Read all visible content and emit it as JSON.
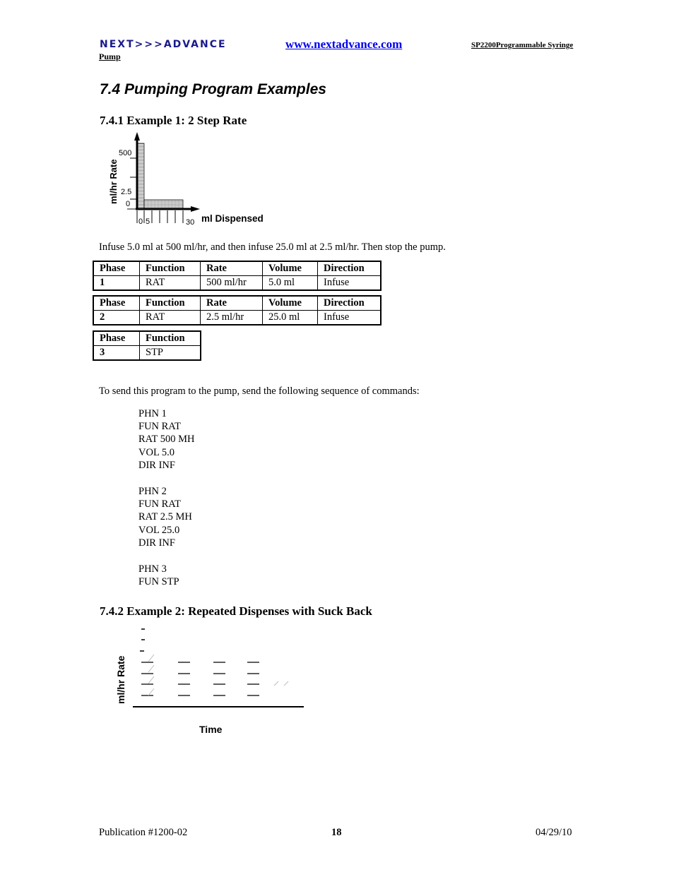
{
  "header": {
    "logo": "NEXT>>>ADVANCE",
    "pump": "Pump",
    "url": "www.nextadvance.com",
    "product": "SP2200Programmable Syringe"
  },
  "section_title": "7.4  Pumping Program Examples",
  "example1": {
    "title": "7.4.1   Example 1:  2 Step Rate",
    "chart": {
      "ylabel": "ml/hr Rate",
      "xlabel": "ml Dispensed",
      "yticks": [
        "500",
        "2.5",
        "0"
      ],
      "xticks": [
        "0",
        "5",
        "30"
      ]
    },
    "description": "Infuse 5.0 ml at 500 ml/hr, and then infuse 25.0 ml at 2.5 ml/hr.  Then stop the pump.",
    "tables": [
      {
        "headers": [
          "Phase",
          "Function",
          "Rate",
          "Volume",
          "Direction"
        ],
        "values": [
          "1",
          "RAT",
          "500 ml/hr",
          "5.0 ml",
          "Infuse"
        ]
      },
      {
        "headers": [
          "Phase",
          "Function",
          "Rate",
          "Volume",
          "Direction"
        ],
        "values": [
          "2",
          "RAT",
          "2.5 ml/hr",
          "25.0 ml",
          "Infuse"
        ]
      },
      {
        "headers": [
          "Phase",
          "Function"
        ],
        "values": [
          "3",
          "STP"
        ]
      }
    ],
    "send_text": "To send this program to the pump, send the following sequence of commands:",
    "commands": [
      [
        "PHN 1",
        "FUN RAT",
        "RAT 500 MH",
        "VOL 5.0",
        "DIR INF"
      ],
      [
        "PHN 2",
        "FUN RAT",
        "RAT 2.5 MH",
        "VOL 25.0",
        "DIR INF"
      ],
      [
        "PHN 3",
        "FUN STP"
      ]
    ]
  },
  "example2": {
    "title": "7.4.2   Example 2:  Repeated Dispenses with Suck Back",
    "chart": {
      "ylabel": "ml/hr Rate",
      "xlabel": "Time"
    }
  },
  "footer": {
    "publication": "Publication  #1200-02",
    "page": "18",
    "date": "04/29/10"
  }
}
